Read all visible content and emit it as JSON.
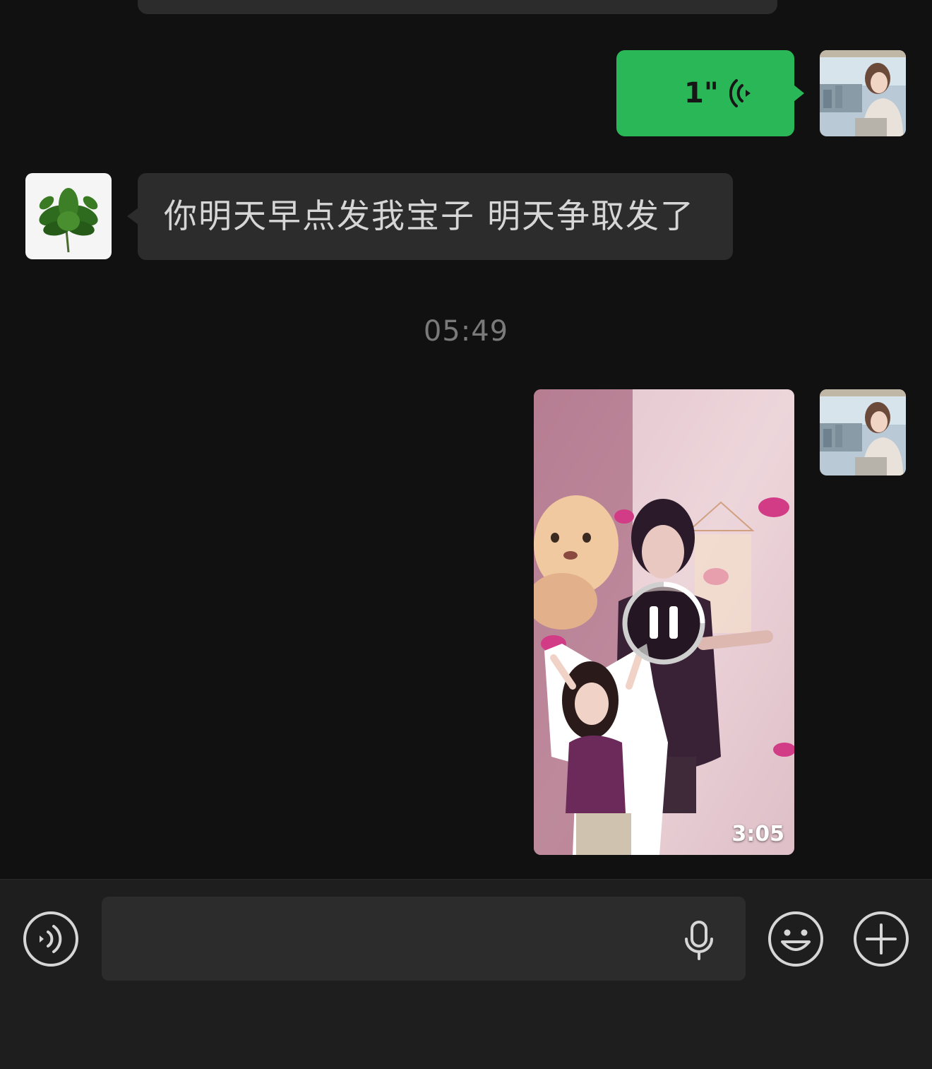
{
  "chat": {
    "messages": [
      {
        "type": "voice",
        "side": "right",
        "duration": "1\""
      },
      {
        "type": "text",
        "side": "left",
        "text": "你明天早点发我宝子 明天争取发了"
      },
      {
        "type": "timestamp",
        "text": "05:49"
      },
      {
        "type": "video",
        "side": "right",
        "duration": "3:05",
        "state": "playing"
      }
    ]
  },
  "input_bar": {
    "text_value": "",
    "placeholder": ""
  },
  "colors": {
    "background": "#111111",
    "sent_bubble": "#2ab757",
    "received_bubble": "#2c2c2c",
    "input_bar": "#1e1e1e",
    "timestamp_text": "#7a7a7a"
  },
  "icons": {
    "voice_toggle": "voice-wave-icon",
    "mic": "mic-icon",
    "emoji": "smiley-icon",
    "more": "plus-icon",
    "video_control": "pause-icon"
  }
}
